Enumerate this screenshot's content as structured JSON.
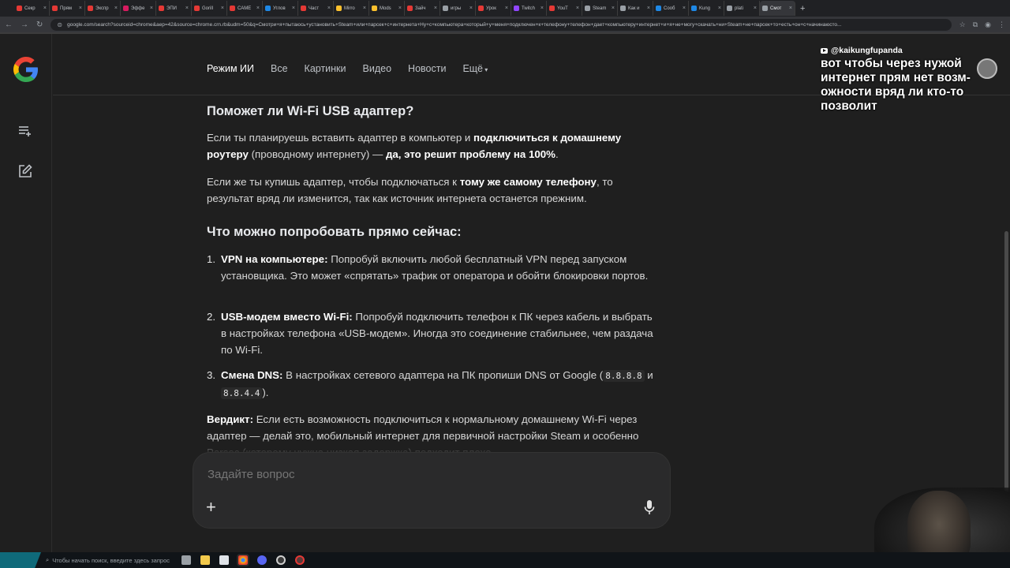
{
  "browser": {
    "tabs": [
      {
        "label": "Секр",
        "color": "#e53935"
      },
      {
        "label": "Прям",
        "color": "#e53935"
      },
      {
        "label": "Экспр",
        "color": "#e53935"
      },
      {
        "label": "Эффе",
        "color": "#d81b60"
      },
      {
        "label": "ЭПИ",
        "color": "#e53935"
      },
      {
        "label": "Gorill",
        "color": "#e53935"
      },
      {
        "label": "САМЕ",
        "color": "#e53935"
      },
      {
        "label": "Углов",
        "color": "#1e88e5"
      },
      {
        "label": "Част",
        "color": "#e53935"
      },
      {
        "label": "Mirro",
        "color": "#fbc02d"
      },
      {
        "label": "Mods",
        "color": "#fbc02d"
      },
      {
        "label": "Зайч",
        "color": "#e53935"
      },
      {
        "label": "игры",
        "color": "#9aa0a6"
      },
      {
        "label": "Урок",
        "color": "#e53935"
      },
      {
        "label": "Twitch",
        "color": "#9146ff"
      },
      {
        "label": "YouT",
        "color": "#e53935"
      },
      {
        "label": "Steam",
        "color": "#9aa0a6"
      },
      {
        "label": "Как и",
        "color": "#9aa0a6"
      },
      {
        "label": "Сооб",
        "color": "#1e88e5"
      },
      {
        "label": "Kung",
        "color": "#1e88e5"
      },
      {
        "label": "plati",
        "color": "#9aa0a6"
      },
      {
        "label": "Смот",
        "color": "#9aa0a6",
        "active": true
      }
    ],
    "url": "google.com/search?sourceid=chrome&aep=42&source=chrome.crn.rb&udm=50&q=Смотри+я+пытаюсь+установить+Steam+или+парсек+с+интернета+Ну+с+компьютера+который+у+меня+подключен+к+телефону+телефон+дает+компьютеру+интернет+и+я+не+могу+скачать+ни+Steam+не+парсек+то+есть+он+с+начинаюсто..."
  },
  "nav": {
    "tabs": [
      "Режим ИИ",
      "Все",
      "Картинки",
      "Видео",
      "Новости",
      "Ещё"
    ]
  },
  "content": {
    "heading1": "Поможет ли Wi-Fi USB адаптер?",
    "p1": [
      {
        "t": "Если ты планируешь вставить адаптер в компьютер и ",
        "b": false
      },
      {
        "t": "подключиться к домашнему роутеру",
        "b": true
      },
      {
        "t": " (проводному интернету) — ",
        "b": false
      },
      {
        "t": "да, это решит проблему на 100%",
        "b": true
      },
      {
        "t": ".",
        "b": false
      }
    ],
    "p2": [
      {
        "t": "Если же ты купишь адаптер, чтобы подключаться к ",
        "b": false
      },
      {
        "t": "тому же самому телефону",
        "b": true
      },
      {
        "t": ", то результат вряд ли изменится, так как источник интернета останется прежним.",
        "b": false
      }
    ],
    "heading2": "Что можно попробовать прямо сейчас:",
    "items": [
      {
        "num": "1.",
        "title": "VPN на компьютере:",
        "text": " Попробуй включить любой бесплатный VPN перед запуском установщика. Это может «спрятать» трафик от оператора и обойти блокировки портов."
      },
      {
        "num": "2.",
        "title": "USB-модем вместо Wi-Fi:",
        "text": " Попробуй подключить телефон к ПК через кабель и выбрать в настройках телефона «USB-модем». Иногда это соединение стабильнее, чем раздача по Wi-Fi."
      },
      {
        "num": "3.",
        "title": "Смена DNS:",
        "text": " В настройках сетевого адаптера на ПК пропиши DNS от Google (",
        "code1": "8.8.8.8",
        "mid": " и ",
        "code2": "8.8.4.4",
        "end": ")."
      }
    ],
    "verdict_label": "Вердикт:",
    "verdict_text": " Если есть возможность подключиться к нормальному домашнему Wi-Fi через адаптер — делай это, мобильный интернет для первичной настройки Steam и особенно Parsec (которому нужна низкая задержка) подходит плохо."
  },
  "ask": {
    "placeholder": "Задайте вопрос"
  },
  "overlay": {
    "username": "@kaikungfupanda",
    "message": "вот чтобы через нужой интернет прям нет возм-ожности вряд ли кто-то позволит"
  },
  "taskbar": {
    "search_placeholder": "Чтобы начать поиск, введите здесь запрос"
  }
}
